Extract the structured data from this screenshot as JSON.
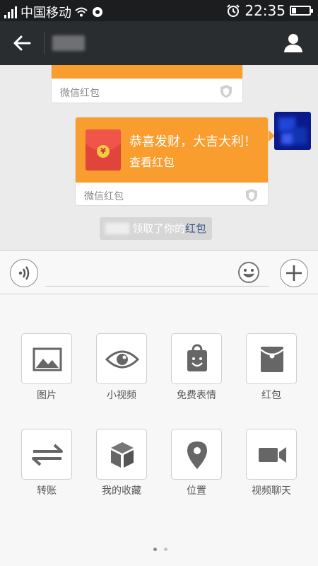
{
  "status_bar": {
    "carrier": "中国移动",
    "time": "22:35"
  },
  "chat": {
    "first_card_footer": "微信红包",
    "red_packet": {
      "greeting": "恭喜发财，大吉大利！",
      "action": "查看红包",
      "footer": "微信红包",
      "coin_symbol": "¥"
    },
    "notice": {
      "text": "领取了你的",
      "link": "红包"
    }
  },
  "panel": {
    "items": [
      {
        "label": "图片",
        "icon": "image-icon"
      },
      {
        "label": "小视频",
        "icon": "eye-icon"
      },
      {
        "label": "免费表情",
        "icon": "sticker-bag-icon"
      },
      {
        "label": "红包",
        "icon": "red-packet-icon"
      },
      {
        "label": "转账",
        "icon": "transfer-icon"
      },
      {
        "label": "我的收藏",
        "icon": "favorites-cube-icon"
      },
      {
        "label": "位置",
        "icon": "location-pin-icon"
      },
      {
        "label": "视频聊天",
        "icon": "video-camera-icon"
      }
    ],
    "page_count": 2,
    "current_page": 1
  },
  "colors": {
    "accent_orange": "#f99d2f",
    "nav_bg": "#2a2d30",
    "status_bg": "#1b1d1f",
    "link": "#3c5a8c"
  }
}
